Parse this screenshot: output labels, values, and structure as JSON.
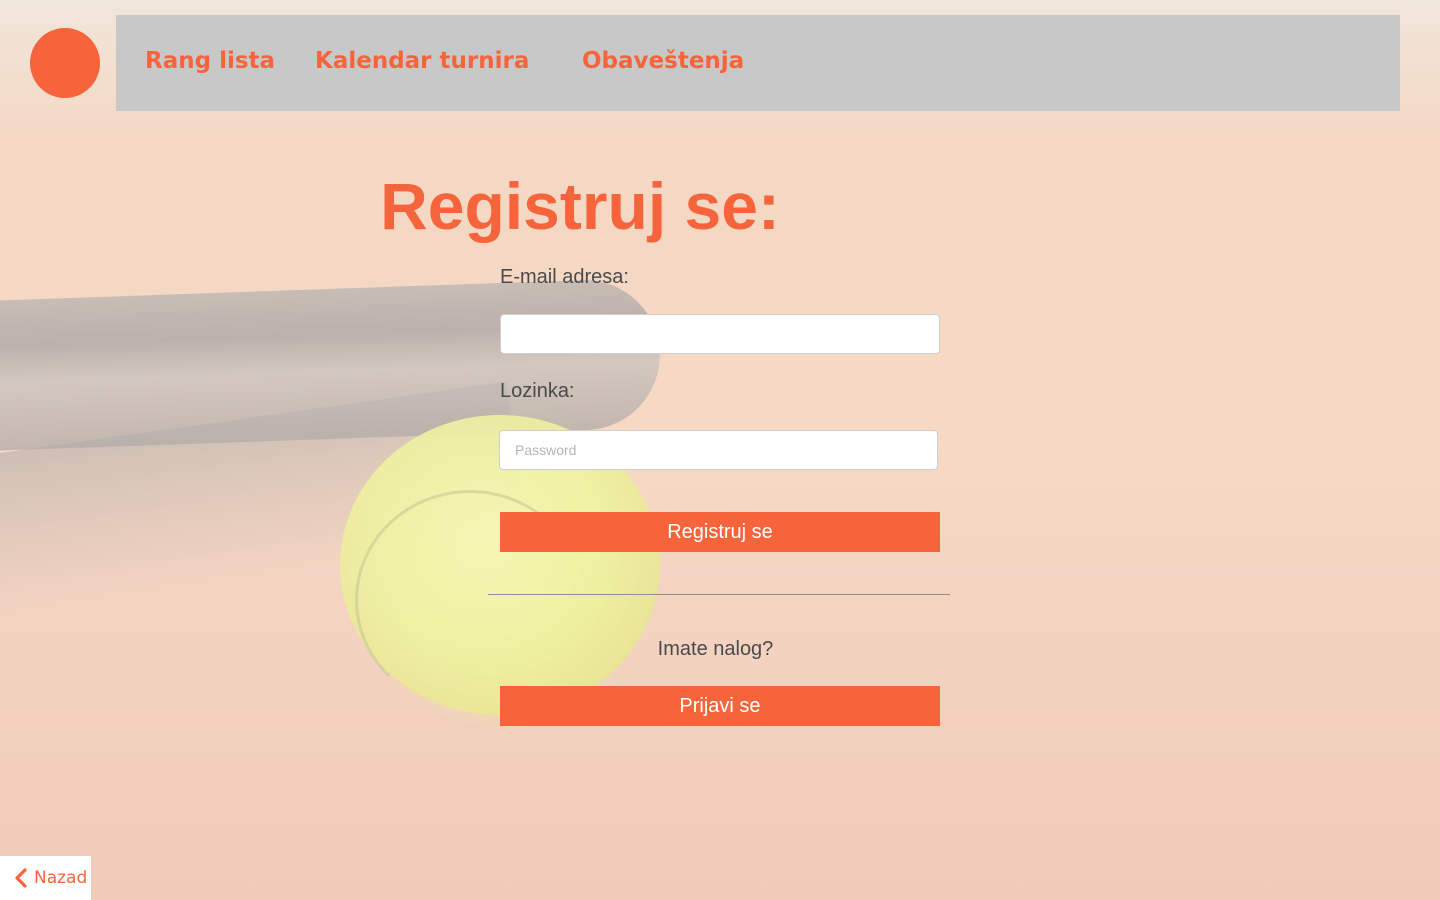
{
  "nav": {
    "links": [
      {
        "label": "Rang lista"
      },
      {
        "label": "Kalendar turnira"
      },
      {
        "label": "Obaveštenja"
      }
    ]
  },
  "form": {
    "title": "Registruj se:",
    "email_label": "E-mail adresa:",
    "email_value": "",
    "password_label": "Lozinka:",
    "password_placeholder": "Password",
    "register_button": "Registruj se",
    "have_account": "Imate nalog?",
    "login_button": "Prijavi se"
  },
  "back": {
    "label": "Nazad",
    "icon": "chevron-left-icon"
  },
  "colors": {
    "accent": "#f6643c",
    "navbar": "#c8c8c8"
  }
}
